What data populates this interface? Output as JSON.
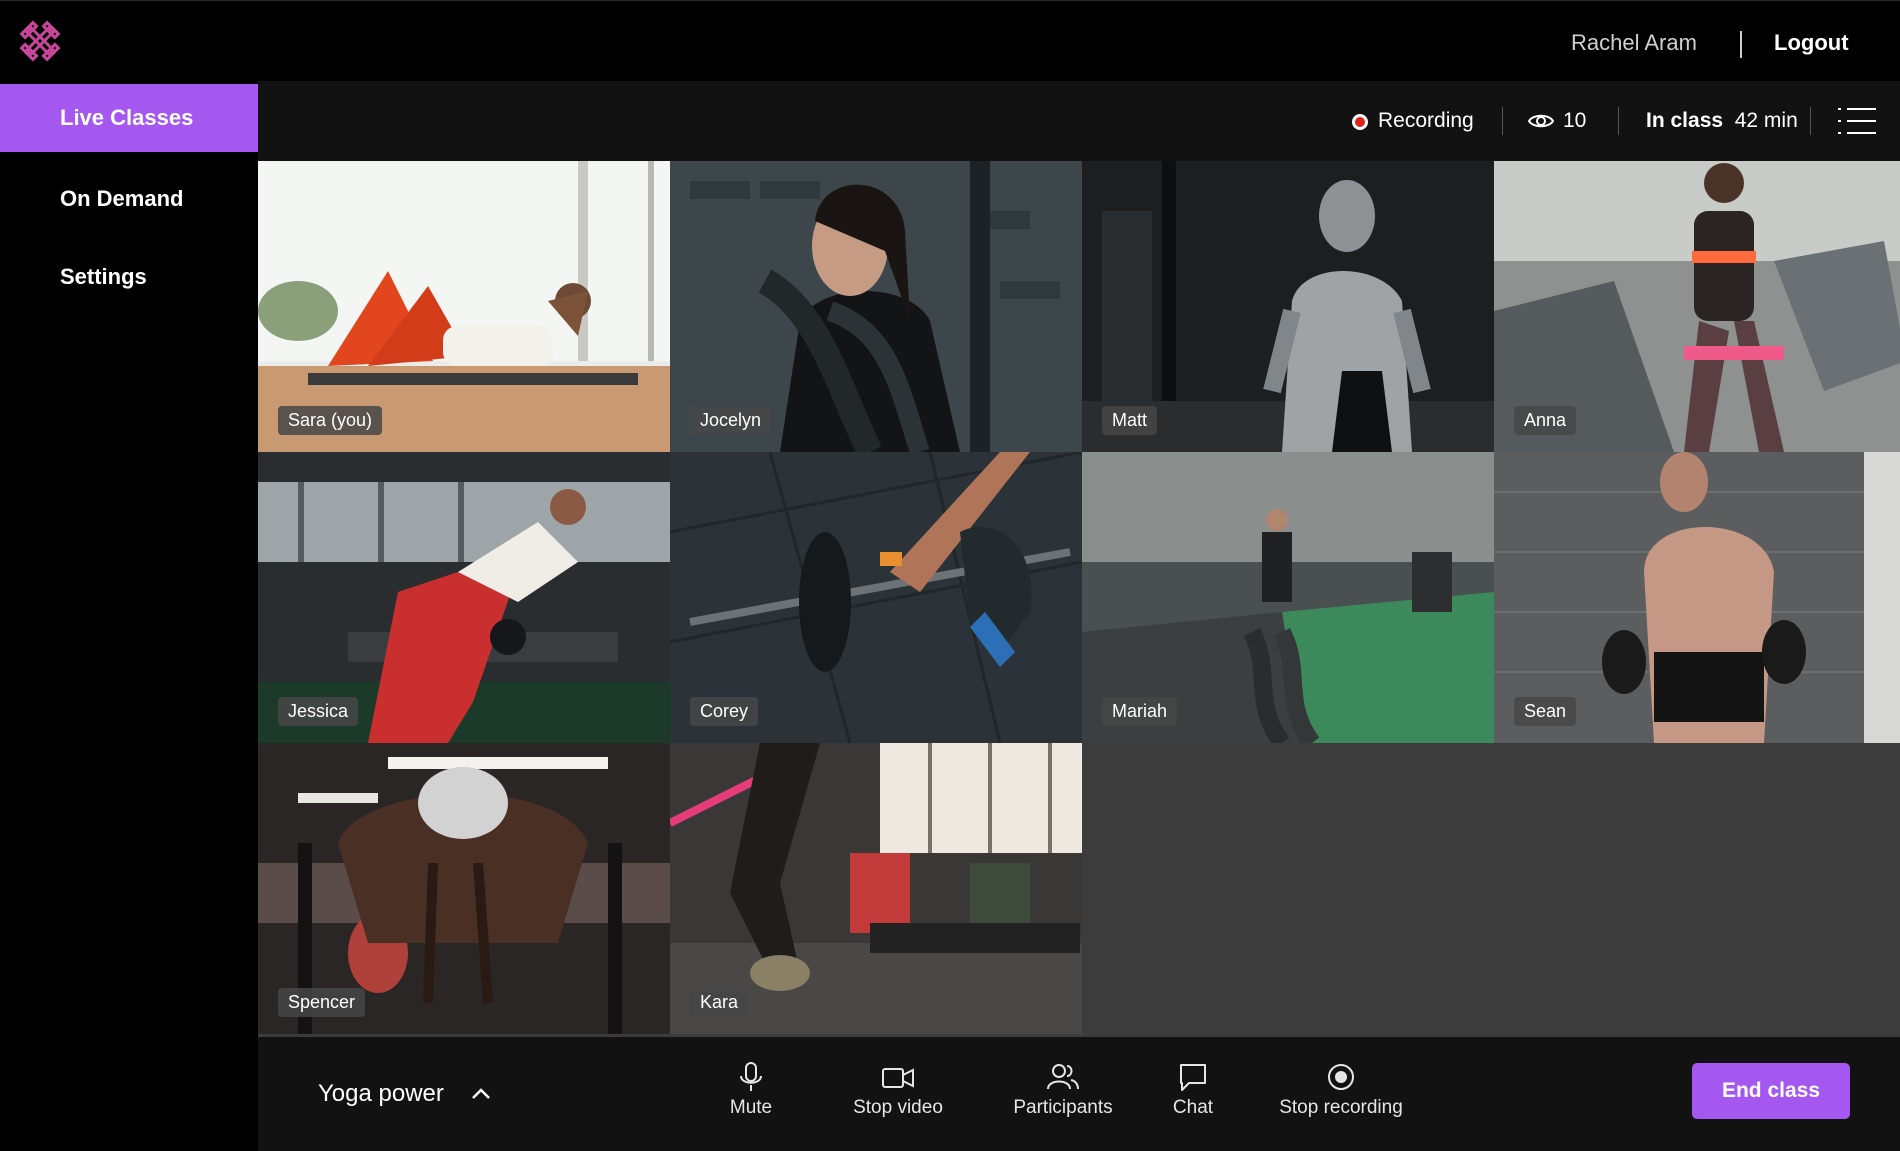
{
  "header": {
    "user_name": "Rachel Aram",
    "logout_label": "Logout",
    "logo_icon": "dumbbell-cross-logo"
  },
  "sidebar": {
    "items": [
      {
        "label": "Live Classes",
        "active": true
      },
      {
        "label": "On Demand",
        "active": false
      },
      {
        "label": "Settings",
        "active": false
      }
    ]
  },
  "status": {
    "recording_label": "Recording",
    "viewer_count": "10",
    "in_class_label": "In class",
    "in_class_time": "42 min"
  },
  "participants": [
    {
      "name": "Sara (you)",
      "scene": "yoga-situp-bright"
    },
    {
      "name": "Jocelyn",
      "scene": "battle-rope-woman"
    },
    {
      "name": "Matt",
      "scene": "cable-curl-dark-gym"
    },
    {
      "name": "Anna",
      "scene": "stepper-machine"
    },
    {
      "name": "Jessica",
      "scene": "dumbbell-row"
    },
    {
      "name": "Corey",
      "scene": "barbell-deadlift"
    },
    {
      "name": "Mariah",
      "scene": "battle-ropes-turf"
    },
    {
      "name": "Sean",
      "scene": "boxer-gloves"
    },
    {
      "name": "Spencer",
      "scene": "sled-push"
    },
    {
      "name": "Kara",
      "scene": "box-jump-class"
    }
  ],
  "controls": {
    "class_name": "Yoga power",
    "mute_label": "Mute",
    "stop_video_label": "Stop video",
    "participants_label": "Participants",
    "chat_label": "Chat",
    "stop_recording_label": "Stop recording",
    "end_class_label": "End class"
  },
  "colors": {
    "accent": "#a558f0",
    "recording": "#e0201c",
    "background": "#121212",
    "grid_empty": "#3c3c3c"
  }
}
